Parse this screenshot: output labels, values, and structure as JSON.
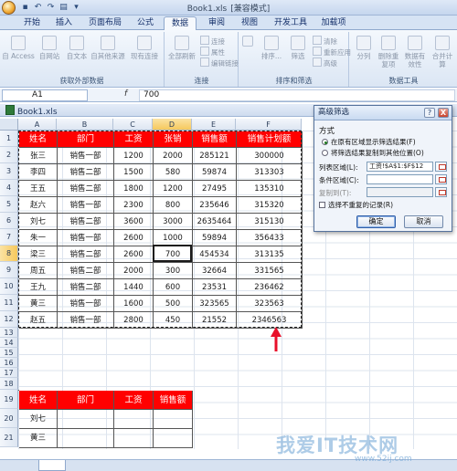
{
  "window": {
    "title": "Book1.xls",
    "mode": "[兼容模式]"
  },
  "ribbon_tabs": [
    "开始",
    "插入",
    "页面布局",
    "公式",
    "数据",
    "审阅",
    "视图",
    "开发工具",
    "加载项"
  ],
  "active_tab": "数据",
  "ribbon": {
    "external": {
      "label": "获取外部数据",
      "buttons": [
        "自 Access",
        "自网站",
        "自文本",
        "自其他来源",
        "现有连接"
      ]
    },
    "connections": {
      "label": "连接",
      "refresh": "全部刷新",
      "items": [
        "连接",
        "属性",
        "编辑链接"
      ]
    },
    "sortfilter": {
      "label": "排序和筛选",
      "sort": "排序...",
      "filter": "筛选",
      "items": [
        "清除",
        "重新应用",
        "高级"
      ]
    },
    "datatools": {
      "label": "数据工具",
      "buttons": [
        "分列",
        "删除重复项",
        "数据有效性",
        "合并计算"
      ]
    }
  },
  "formula_bar": {
    "name_box": "A1",
    "fx": "f",
    "value": "700"
  },
  "workbook_tab": "Book1.xls",
  "columns": [
    "A",
    "B",
    "C",
    "D",
    "E",
    "F"
  ],
  "rows": [
    "1",
    "2",
    "3",
    "4",
    "5",
    "6",
    "7",
    "8",
    "9",
    "10",
    "11",
    "12",
    "13",
    "14",
    "15",
    "16",
    "17",
    "18",
    "19",
    "20",
    "21"
  ],
  "main_table": {
    "headers": [
      "姓名",
      "部门",
      "工资",
      "张销",
      "销售额",
      "销售计划额"
    ],
    "rows": [
      [
        "张三",
        "销售一部",
        "1200",
        "2000",
        "285121",
        "300000"
      ],
      [
        "李四",
        "销售二部",
        "1500",
        "580",
        "59874",
        "313303"
      ],
      [
        "王五",
        "销售二部",
        "1800",
        "1200",
        "27495",
        "135310"
      ],
      [
        "赵六",
        "销售一部",
        "2300",
        "800",
        "235646",
        "315320"
      ],
      [
        "刘七",
        "销售二部",
        "3600",
        "3000",
        "2635464",
        "315130"
      ],
      [
        "朱一",
        "销售一部",
        "2600",
        "1000",
        "59894",
        "356433"
      ],
      [
        "梁三",
        "销售二部",
        "2600",
        "700",
        "454534",
        "313135"
      ],
      [
        "周五",
        "销售二部",
        "2000",
        "300",
        "32664",
        "331565"
      ],
      [
        "王九",
        "销售二部",
        "1440",
        "600",
        "23531",
        "236462"
      ],
      [
        "黄三",
        "销售一部",
        "1600",
        "500",
        "323565",
        "323563"
      ],
      [
        "赵五",
        "销售一部",
        "2800",
        "450",
        "21552",
        "2346563"
      ]
    ]
  },
  "criteria_table": {
    "headers": [
      "姓名",
      "部门",
      "工资",
      "销售额"
    ],
    "rows": [
      [
        "刘七",
        "",
        "",
        ""
      ],
      [
        "黄三",
        "",
        "",
        ""
      ]
    ]
  },
  "dialog": {
    "title": "高级筛选",
    "help": "?",
    "close": "X",
    "section": "方式",
    "options": [
      "在原有区域显示筛选结果(F)",
      "将筛选结果复制到其他位置(O)"
    ],
    "list_range_label": "列表区域(L):",
    "list_range_value": "工资!$A$1:$F$12",
    "criteria_label": "条件区域(C):",
    "copy_to_label": "复制到(T):",
    "unique_label": "选择不重复的记录(R)",
    "ok": "确定",
    "cancel": "取消"
  },
  "watermark": {
    "text": "我爱IT技术网",
    "url": "www.52ij.com"
  },
  "colors": {
    "header_red": "#ff0000",
    "selected_header": "#f6c85c",
    "arrow": "#e8102a",
    "excel_blue": "#d6e3f4"
  }
}
